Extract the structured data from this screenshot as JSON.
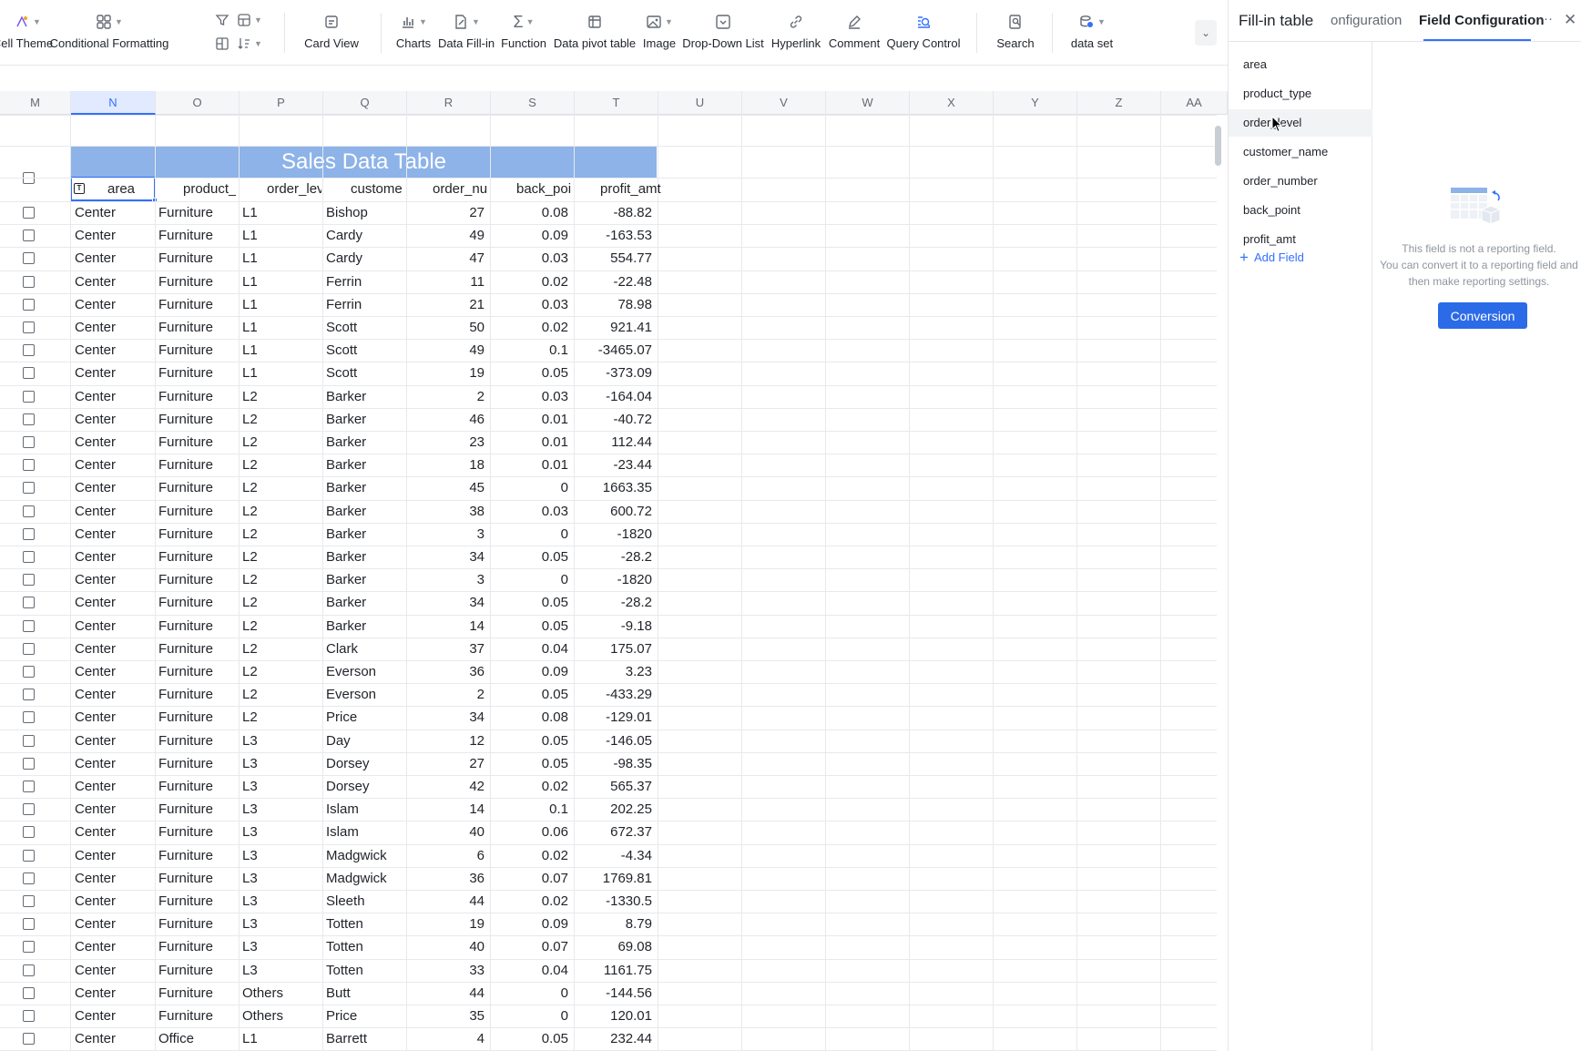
{
  "toolbar": {
    "cell_theme": "Cell Theme",
    "conditional_formatting": "Conditional Formatting",
    "card_view": "Card View",
    "charts": "Charts",
    "data_fill_in": "Data Fill-in",
    "function": "Function",
    "data_pivot_table": "Data pivot table",
    "image": "Image",
    "drop_down_list": "Drop-Down List",
    "hyperlink": "Hyperlink",
    "comment": "Comment",
    "query_control": "Query Control",
    "search": "Search",
    "data_set": "data set",
    "accent_color": "#3370ff"
  },
  "columns": [
    "M",
    "N",
    "O",
    "P",
    "Q",
    "R",
    "S",
    "T",
    "U",
    "V",
    "W",
    "X",
    "Y",
    "Z",
    "AA"
  ],
  "selected_column": "N",
  "table": {
    "title": "Sales Data Table",
    "title_bg": "#8db3e8",
    "headers": [
      "area",
      "product_",
      "order_lev",
      "custome",
      "order_nu",
      "back_poi",
      "profit_amt"
    ],
    "rows": [
      [
        "Center",
        "Furniture",
        "L1",
        "Bishop",
        "27",
        "0.08",
        "-88.82"
      ],
      [
        "Center",
        "Furniture",
        "L1",
        "Cardy",
        "49",
        "0.09",
        "-163.53"
      ],
      [
        "Center",
        "Furniture",
        "L1",
        "Cardy",
        "47",
        "0.03",
        "554.77"
      ],
      [
        "Center",
        "Furniture",
        "L1",
        "Ferrin",
        "11",
        "0.02",
        "-22.48"
      ],
      [
        "Center",
        "Furniture",
        "L1",
        "Ferrin",
        "21",
        "0.03",
        "78.98"
      ],
      [
        "Center",
        "Furniture",
        "L1",
        "Scott",
        "50",
        "0.02",
        "921.41"
      ],
      [
        "Center",
        "Furniture",
        "L1",
        "Scott",
        "49",
        "0.1",
        "-3465.07"
      ],
      [
        "Center",
        "Furniture",
        "L1",
        "Scott",
        "19",
        "0.05",
        "-373.09"
      ],
      [
        "Center",
        "Furniture",
        "L2",
        "Barker",
        "2",
        "0.03",
        "-164.04"
      ],
      [
        "Center",
        "Furniture",
        "L2",
        "Barker",
        "46",
        "0.01",
        "-40.72"
      ],
      [
        "Center",
        "Furniture",
        "L2",
        "Barker",
        "23",
        "0.01",
        "112.44"
      ],
      [
        "Center",
        "Furniture",
        "L2",
        "Barker",
        "18",
        "0.01",
        "-23.44"
      ],
      [
        "Center",
        "Furniture",
        "L2",
        "Barker",
        "45",
        "0",
        "1663.35"
      ],
      [
        "Center",
        "Furniture",
        "L2",
        "Barker",
        "38",
        "0.03",
        "600.72"
      ],
      [
        "Center",
        "Furniture",
        "L2",
        "Barker",
        "3",
        "0",
        "-1820"
      ],
      [
        "Center",
        "Furniture",
        "L2",
        "Barker",
        "34",
        "0.05",
        "-28.2"
      ],
      [
        "Center",
        "Furniture",
        "L2",
        "Barker",
        "3",
        "0",
        "-1820"
      ],
      [
        "Center",
        "Furniture",
        "L2",
        "Barker",
        "34",
        "0.05",
        "-28.2"
      ],
      [
        "Center",
        "Furniture",
        "L2",
        "Barker",
        "14",
        "0.05",
        "-9.18"
      ],
      [
        "Center",
        "Furniture",
        "L2",
        "Clark",
        "37",
        "0.04",
        "175.07"
      ],
      [
        "Center",
        "Furniture",
        "L2",
        "Everson",
        "36",
        "0.09",
        "3.23"
      ],
      [
        "Center",
        "Furniture",
        "L2",
        "Everson",
        "2",
        "0.05",
        "-433.29"
      ],
      [
        "Center",
        "Furniture",
        "L2",
        "Price",
        "34",
        "0.08",
        "-129.01"
      ],
      [
        "Center",
        "Furniture",
        "L3",
        "Day",
        "12",
        "0.05",
        "-146.05"
      ],
      [
        "Center",
        "Furniture",
        "L3",
        "Dorsey",
        "27",
        "0.05",
        "-98.35"
      ],
      [
        "Center",
        "Furniture",
        "L3",
        "Dorsey",
        "42",
        "0.02",
        "565.37"
      ],
      [
        "Center",
        "Furniture",
        "L3",
        "Islam",
        "14",
        "0.1",
        "202.25"
      ],
      [
        "Center",
        "Furniture",
        "L3",
        "Islam",
        "40",
        "0.06",
        "672.37"
      ],
      [
        "Center",
        "Furniture",
        "L3",
        "Madgwick",
        "6",
        "0.02",
        "-4.34"
      ],
      [
        "Center",
        "Furniture",
        "L3",
        "Madgwick",
        "36",
        "0.07",
        "1769.81"
      ],
      [
        "Center",
        "Furniture",
        "L3",
        "Sleeth",
        "44",
        "0.02",
        "-1330.5"
      ],
      [
        "Center",
        "Furniture",
        "L3",
        "Totten",
        "19",
        "0.09",
        "8.79"
      ],
      [
        "Center",
        "Furniture",
        "L3",
        "Totten",
        "40",
        "0.07",
        "69.08"
      ],
      [
        "Center",
        "Furniture",
        "L3",
        "Totten",
        "33",
        "0.04",
        "1161.75"
      ],
      [
        "Center",
        "Furniture",
        "Others",
        "Butt",
        "44",
        "0",
        "-144.56"
      ],
      [
        "Center",
        "Furniture",
        "Others",
        "Price",
        "35",
        "0",
        "120.01"
      ],
      [
        "Center",
        "Office",
        "L1",
        "Barrett",
        "4",
        "0.05",
        "232.44"
      ]
    ]
  },
  "panel": {
    "tab_fill_in": "Fill-in table",
    "tab_config_partial": "onfiguration",
    "tab_field_config": "Field Configuration",
    "more": "···",
    "close": "✕",
    "fields": [
      "area",
      "product_type",
      "order_level",
      "customer_name",
      "order_number",
      "back_point",
      "profit_amt"
    ],
    "hovered_field": "order_level",
    "add_field": "Add Field",
    "empty_line1": "This field is not a reporting field.",
    "empty_line2": "You can convert it to a reporting field and",
    "empty_line3": "then make reporting settings.",
    "conversion_button": "Conversion"
  }
}
